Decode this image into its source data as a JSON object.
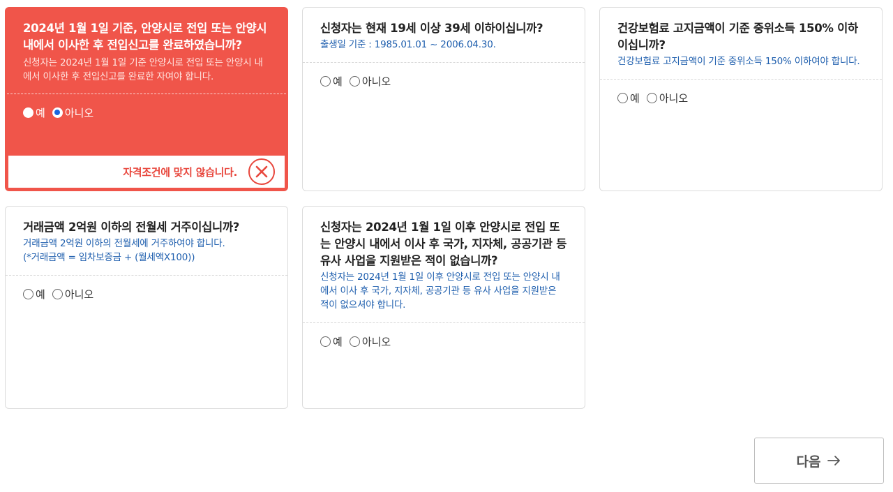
{
  "questions": [
    {
      "title": "2024년 1월 1일 기준, 안양시로 전입 또는 안양시 내에서 이사한 후 전입신고를 완료하였습니까?",
      "desc": "신청자는 2024년 1월 1일 기준 안양시로 전입 또는 안양시 내에서 이사한 후 전입신고를 완료한 자여야 합니다.",
      "yes": "예",
      "no": "아니오",
      "selected": "no",
      "fail_message": "자격조건에 맞지 않습니다."
    },
    {
      "title": "신청자는 현재 19세 이상 39세 이하이십니까?",
      "desc": "출생일 기준 : 1985.01.01 ~ 2006.04.30.",
      "yes": "예",
      "no": "아니오",
      "selected": ""
    },
    {
      "title": "건강보험료 고지금액이 기준 중위소득 150% 이하이십니까?",
      "desc": "건강보험료 고지금액이 기준 중위소득 150% 이하여야 합니다.",
      "yes": "예",
      "no": "아니오",
      "selected": ""
    },
    {
      "title": "거래금액 2억원 이하의 전월세 거주이십니까?",
      "desc": "거래금액 2억원 이하의 전월세에 거주하여야 합니다.",
      "desc2": "(*거래금액 = 임차보증금 + (월세액X100))",
      "yes": "예",
      "no": "아니오",
      "selected": ""
    },
    {
      "title": "신청자는 2024년 1월 1일 이후 안양시로 전입 또는 안양시 내에서 이사 후 국가, 지자체, 공공기관 등 유사 사업을 지원받은 적이 없습니까?",
      "desc": "신청자는 2024년 1월 1일 이후 안양시로 전입 또는 안양시 내에서 이사 후 국가, 지자체, 공공기관 등 유사 사업을 지원받은 적이 없으셔야 합니다.",
      "yes": "예",
      "no": "아니오",
      "selected": ""
    }
  ],
  "next_button": {
    "label": "다음",
    "icon": "arrow-right-icon"
  },
  "colors": {
    "fail": "#f0554a",
    "desc": "#1f5fae",
    "radio_checked": "#1a66e0"
  }
}
